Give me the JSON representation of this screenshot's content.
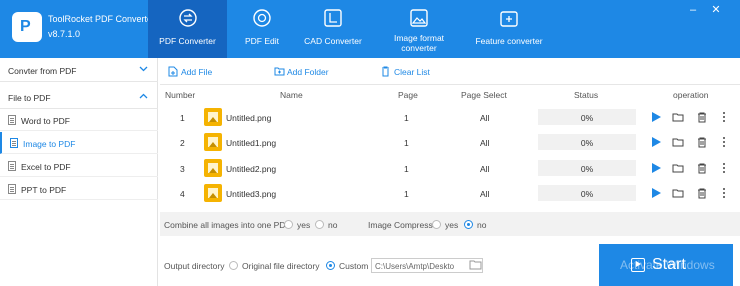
{
  "app": {
    "title": "ToolRocket PDF Converter",
    "version": "v8.7.1.0"
  },
  "nav": [
    {
      "label": "PDF Converter",
      "icon": "convert-icon"
    },
    {
      "label": "PDF Edit",
      "icon": "edit-icon"
    },
    {
      "label": "CAD Converter",
      "icon": "cad-icon"
    },
    {
      "label": "Image format converter",
      "icon": "image-icon"
    },
    {
      "label": "Feature converter",
      "icon": "feature-icon"
    }
  ],
  "sidebar": {
    "groups": [
      {
        "label": "Convter from PDF",
        "expanded": false
      },
      {
        "label": "File to PDF",
        "expanded": true
      }
    ],
    "items": [
      {
        "label": "Word to PDF"
      },
      {
        "label": "Image to PDF"
      },
      {
        "label": "Excel to PDF"
      },
      {
        "label": "PPT to PDF"
      }
    ]
  },
  "toolbar": {
    "add_file": "Add File",
    "add_folder": "Add Folder",
    "clear_list": "Clear List"
  },
  "table": {
    "headers": {
      "number": "Number",
      "name": "Name",
      "page": "Page",
      "page_select": "Page Select",
      "status": "Status",
      "operation": "operation"
    },
    "rows": [
      {
        "number": "1",
        "name": "Untitled.png",
        "page": "1",
        "page_select": "All",
        "status": "0%"
      },
      {
        "number": "2",
        "name": "Untitled1.png",
        "page": "1",
        "page_select": "All",
        "status": "0%"
      },
      {
        "number": "3",
        "name": "Untitled2.png",
        "page": "1",
        "page_select": "All",
        "status": "0%"
      },
      {
        "number": "4",
        "name": "Untitled3.png",
        "page": "1",
        "page_select": "All",
        "status": "0%"
      }
    ]
  },
  "options": {
    "combine_label": "Combine all images into one PDF",
    "combine_yes": "yes",
    "combine_no": "no",
    "combine_selected": "none",
    "compress_label": "Image Compress",
    "compress_yes": "yes",
    "compress_no": "no",
    "compress_selected": "no"
  },
  "output": {
    "label": "Output directory",
    "original": "Original file directory",
    "custom": "Custom",
    "selected": "custom",
    "path": "C:\\Users\\Amtp\\Deskto"
  },
  "start_label": "Start",
  "watermark": "Activate Windows",
  "colors": {
    "accent": "#1e88e5",
    "accent_dark": "#1565c0"
  }
}
